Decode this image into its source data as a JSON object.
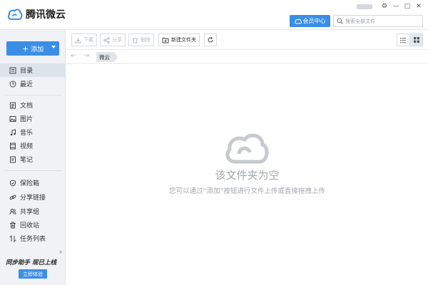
{
  "app": {
    "name": "腾讯微云",
    "brand_color": "#3a8ee6"
  },
  "header": {
    "vip_label": "会员中心",
    "search_placeholder": "搜索全部文件"
  },
  "sidebar": {
    "add_label": "添加",
    "items": [
      {
        "label": "目录",
        "icon": "directory-icon",
        "active": true
      },
      {
        "label": "最近",
        "icon": "clock-icon"
      },
      {
        "label": "文档",
        "icon": "document-icon"
      },
      {
        "label": "图片",
        "icon": "image-icon"
      },
      {
        "label": "音乐",
        "icon": "music-icon"
      },
      {
        "label": "视频",
        "icon": "video-icon"
      },
      {
        "label": "笔记",
        "icon": "note-icon"
      },
      {
        "label": "保险箱",
        "icon": "shield-icon"
      },
      {
        "label": "分享链接",
        "icon": "link-icon"
      },
      {
        "label": "共享组",
        "icon": "group-icon"
      },
      {
        "label": "回收站",
        "icon": "trash-icon"
      },
      {
        "label": "任务列表",
        "icon": "transfer-icon"
      }
    ],
    "promo": {
      "title": "同步助手 现已上线",
      "button": "立即体验",
      "close": "×"
    }
  },
  "toolbar": {
    "download": "下载",
    "share": "分享",
    "delete": "删除",
    "new_folder": "新建文件夹"
  },
  "breadcrumb": {
    "root": "微云"
  },
  "empty_state": {
    "title": "该文件夹为空",
    "hint": "您可以通过“添加”按钮进行文件上传或直接拖拽上传"
  }
}
